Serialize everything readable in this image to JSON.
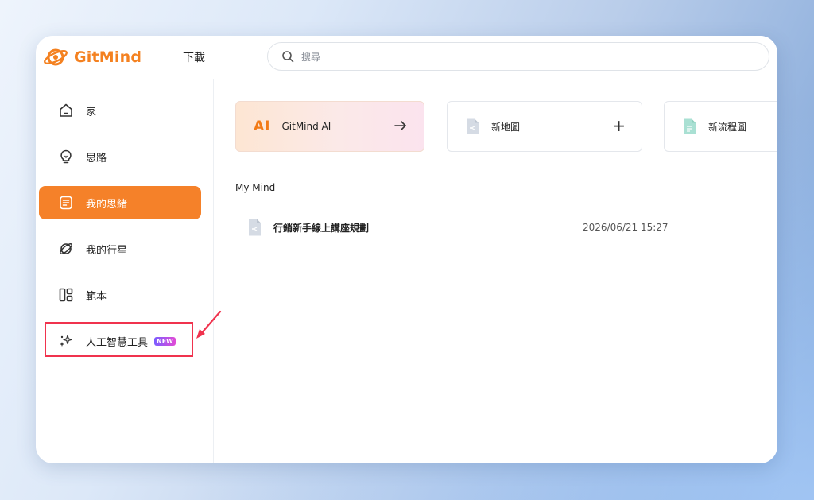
{
  "header": {
    "brand": "GitMind",
    "download_label": "下載",
    "search_placeholder": "搜尋"
  },
  "sidebar": {
    "items": [
      {
        "label": "家"
      },
      {
        "label": "思路"
      },
      {
        "label": "我的思緒",
        "active": true
      },
      {
        "label": "我的行星"
      },
      {
        "label": "範本",
        "highlighted": true
      },
      {
        "label": "人工智慧工具",
        "badge": "NEW"
      }
    ]
  },
  "main": {
    "cards": [
      {
        "icon_text": "AI",
        "label": "GitMind AI",
        "action_icon": "arrow-right-icon"
      },
      {
        "label": "新地圖",
        "action_icon": "plus-icon"
      },
      {
        "label": "新流程圖"
      }
    ],
    "section_title": "My Mind",
    "files": [
      {
        "name": "行銷新手線上講座規劃",
        "date": "2026/06/21 15:27"
      }
    ]
  },
  "colors": {
    "brand_orange": "#f58129",
    "annotation_red": "#f0334e",
    "badge_gradient_start": "#7b5cff",
    "badge_gradient_end": "#e24bd6"
  }
}
